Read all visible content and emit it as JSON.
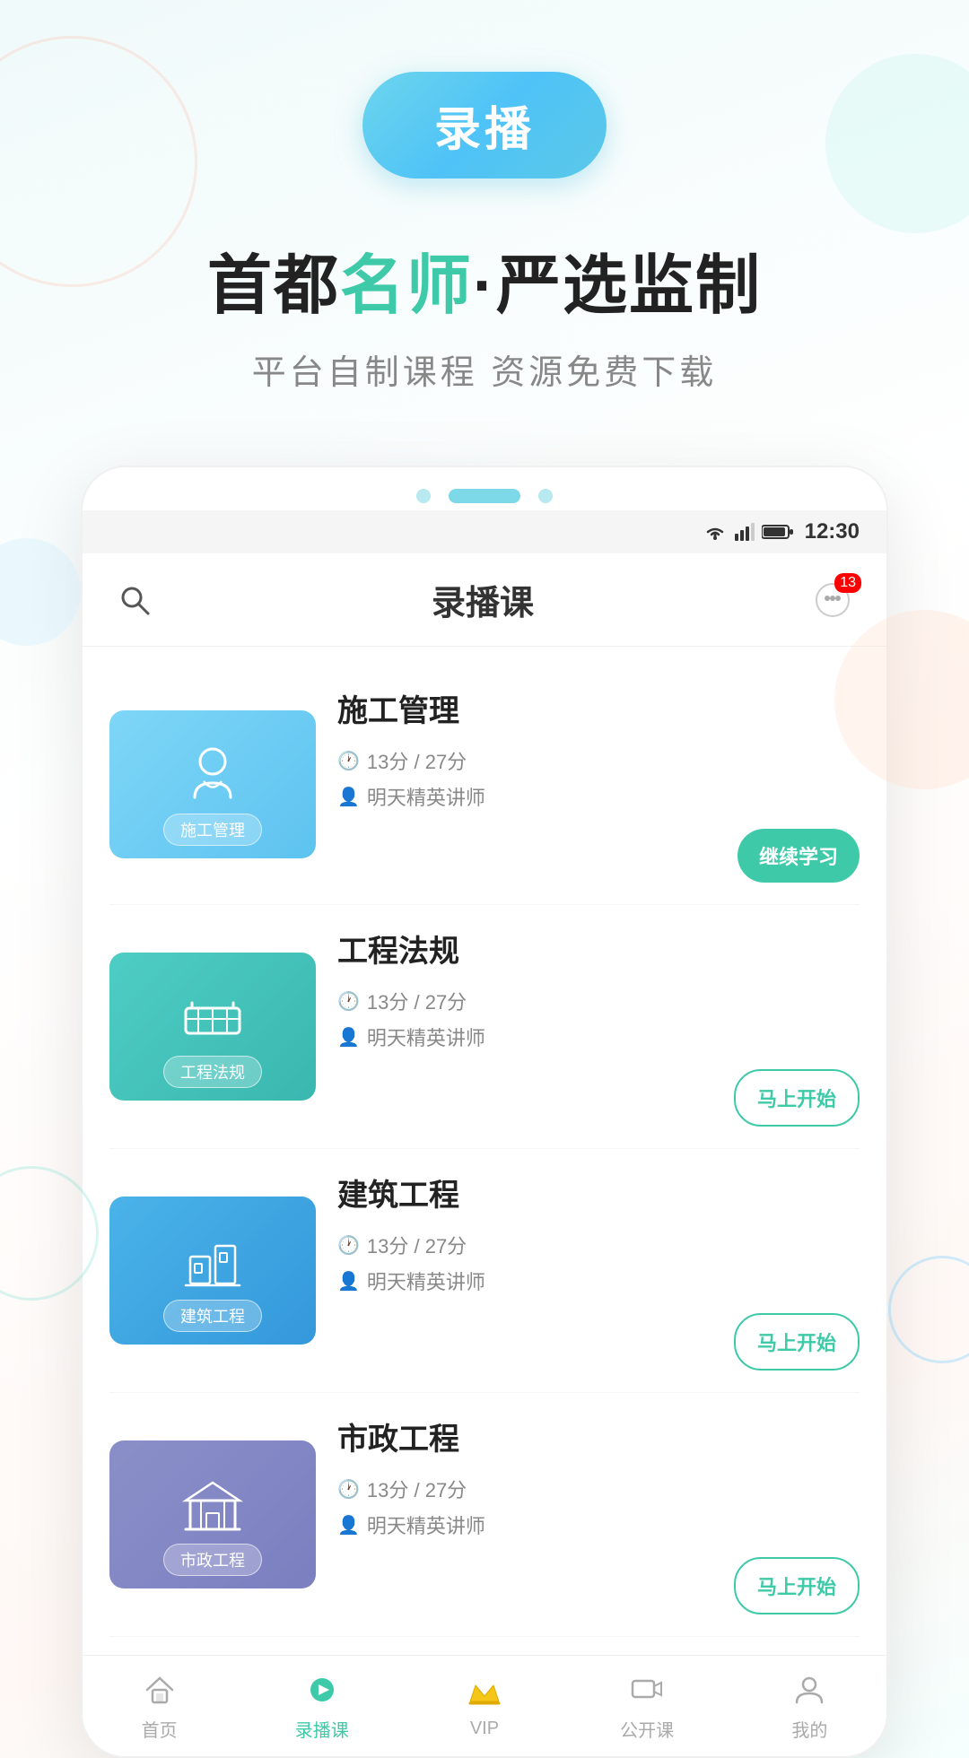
{
  "hero": {
    "badge_label": "录播",
    "title_part1": "首都",
    "title_highlight": "名师",
    "title_part2": "·严选监制",
    "subtitle": "平台自制课程  资源免费下载"
  },
  "phone": {
    "status_time": "12:30",
    "header_title": "录播课",
    "notification_count": "13",
    "dots": [
      "dot",
      "active",
      "dot"
    ]
  },
  "courses": [
    {
      "id": 1,
      "name": "施工管理",
      "thumb_label": "施工管理",
      "thumb_class": "thumb-1",
      "icon": "👷",
      "duration": "13分 / 27分",
      "teacher": "明天精英讲师",
      "btn_label": "继续学习",
      "btn_type": "continue"
    },
    {
      "id": 2,
      "name": "工程法规",
      "thumb_label": "工程法规",
      "thumb_class": "thumb-2",
      "icon": "🚧",
      "duration": "13分 / 27分",
      "teacher": "明天精英讲师",
      "btn_label": "马上开始",
      "btn_type": "start"
    },
    {
      "id": 3,
      "name": "建筑工程",
      "thumb_label": "建筑工程",
      "thumb_class": "thumb-3",
      "icon": "🏢",
      "duration": "13分 / 27分",
      "teacher": "明天精英讲师",
      "btn_label": "马上开始",
      "btn_type": "start"
    },
    {
      "id": 4,
      "name": "市政工程",
      "thumb_label": "市政工程",
      "thumb_class": "thumb-4",
      "icon": "🏛",
      "duration": "13分 / 27分",
      "teacher": "明天精英讲师",
      "btn_label": "马上开始",
      "btn_type": "start"
    }
  ],
  "bottom_nav": [
    {
      "label": "首页",
      "icon": "home",
      "active": false
    },
    {
      "label": "录播课",
      "icon": "record",
      "active": true
    },
    {
      "label": "VIP",
      "icon": "vip",
      "active": false
    },
    {
      "label": "公开课",
      "icon": "video",
      "active": false
    },
    {
      "label": "我的",
      "icon": "user",
      "active": false
    }
  ],
  "colors": {
    "accent": "#3ecaa8",
    "badge_bg": "#5bc8e8",
    "highlight": "#3ecaa8"
  }
}
